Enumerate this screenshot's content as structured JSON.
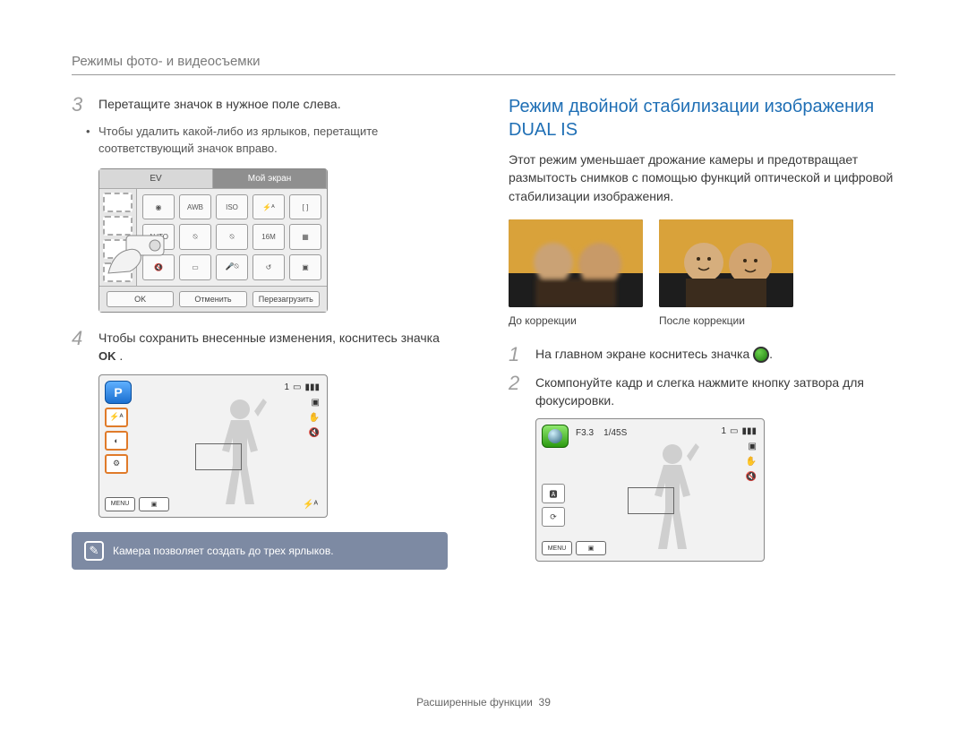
{
  "breadcrumb": "Режимы фото- и видеосъемки",
  "left": {
    "steps": [
      {
        "num": "3",
        "text": "Перетащите значок в нужное поле слева.",
        "bullet": "Чтобы удалить какой-либо из ярлыков, перетащите соответствующий значок вправо."
      },
      {
        "num": "4",
        "text": "Чтобы сохранить внесенные изменения, коснитесь значка",
        "ok": "OK"
      }
    ],
    "edit_screen": {
      "tab_left": "EV",
      "tab_right": "Мой экран",
      "buttons": {
        "ok": "OK",
        "cancel": "Отменить",
        "reset": "Перезагрузить"
      },
      "grid_icons": [
        "dot",
        "AWB",
        "ISO AUTO",
        "flash-A",
        "bracket",
        "AUTO",
        "off",
        "off",
        "16M",
        "grid",
        "voff",
        "sd",
        "voice-off",
        "rev",
        "gallery"
      ]
    },
    "live_screen": {
      "mode_badge": "P",
      "shortcut_icons": [
        "flash-A",
        "contrast",
        "gear"
      ],
      "menu": "MENU",
      "counter": "1",
      "flash_glyph": "⚡ᴬ"
    },
    "note": "Камера позволяет создать до трех ярлыков."
  },
  "right": {
    "title": "Режим двойной стабилизации изображения DUAL IS",
    "desc": "Этот режим уменьшает дрожание камеры и предотвращает размытость снимков с помощью функций оптической и цифровой стабилизации изображения.",
    "captions": {
      "before": "До коррекции",
      "after": "После коррекции"
    },
    "steps": [
      {
        "num": "1",
        "text_before": "На главном экране коснитесь значка",
        "text_after": "."
      },
      {
        "num": "2",
        "text": "Скомпонуйте кадр и слегка нажмите кнопку затвора для фокусировки."
      }
    ],
    "dual_screen": {
      "aperture": "F3.3",
      "shutter": "1/45S",
      "counter": "1",
      "menu": "MENU",
      "left_icons": [
        "AUTO",
        "off"
      ]
    }
  },
  "footer": {
    "section": "Расширенные функции",
    "page": "39"
  }
}
